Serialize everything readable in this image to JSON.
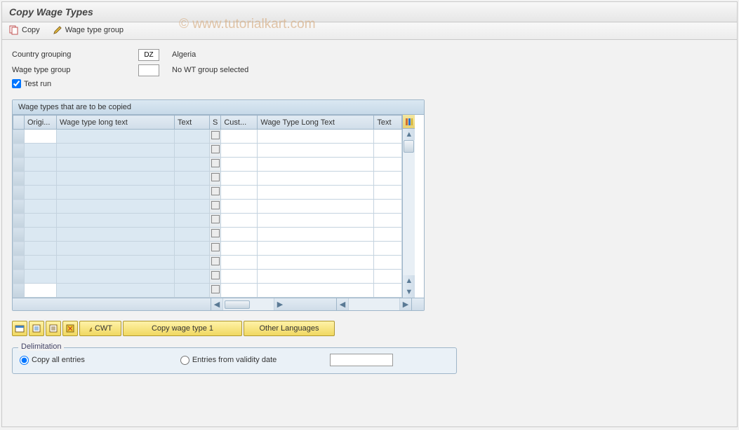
{
  "header": {
    "title": "Copy Wage Types"
  },
  "toolbar": {
    "copy_label": "Copy",
    "wagetype_group_label": "Wage type group"
  },
  "watermark": "© www.tutorialkart.com",
  "form": {
    "country_grouping_label": "Country grouping",
    "country_grouping_value": "DZ",
    "country_grouping_text": "Algeria",
    "wage_type_group_label": "Wage type group",
    "wage_type_group_value": "",
    "wage_type_group_text": "No WT group selected",
    "test_run_label": "Test run",
    "test_run_checked": true
  },
  "grid": {
    "title": "Wage types that are to be copied",
    "columns_left": [
      "Origi...",
      "Wage type long text",
      "Text"
    ],
    "columns_right": [
      "S",
      "Cust...",
      "Wage Type Long Text",
      "Text"
    ],
    "row_count": 12
  },
  "actions": {
    "cwt_label": "CWT",
    "copy_wt1_label": "Copy wage type 1",
    "other_lang_label": "Other Languages"
  },
  "delimitation": {
    "title": "Delimitation",
    "copy_all_label": "Copy all entries",
    "entries_from_label": "Entries from validity date",
    "date_value": ""
  }
}
